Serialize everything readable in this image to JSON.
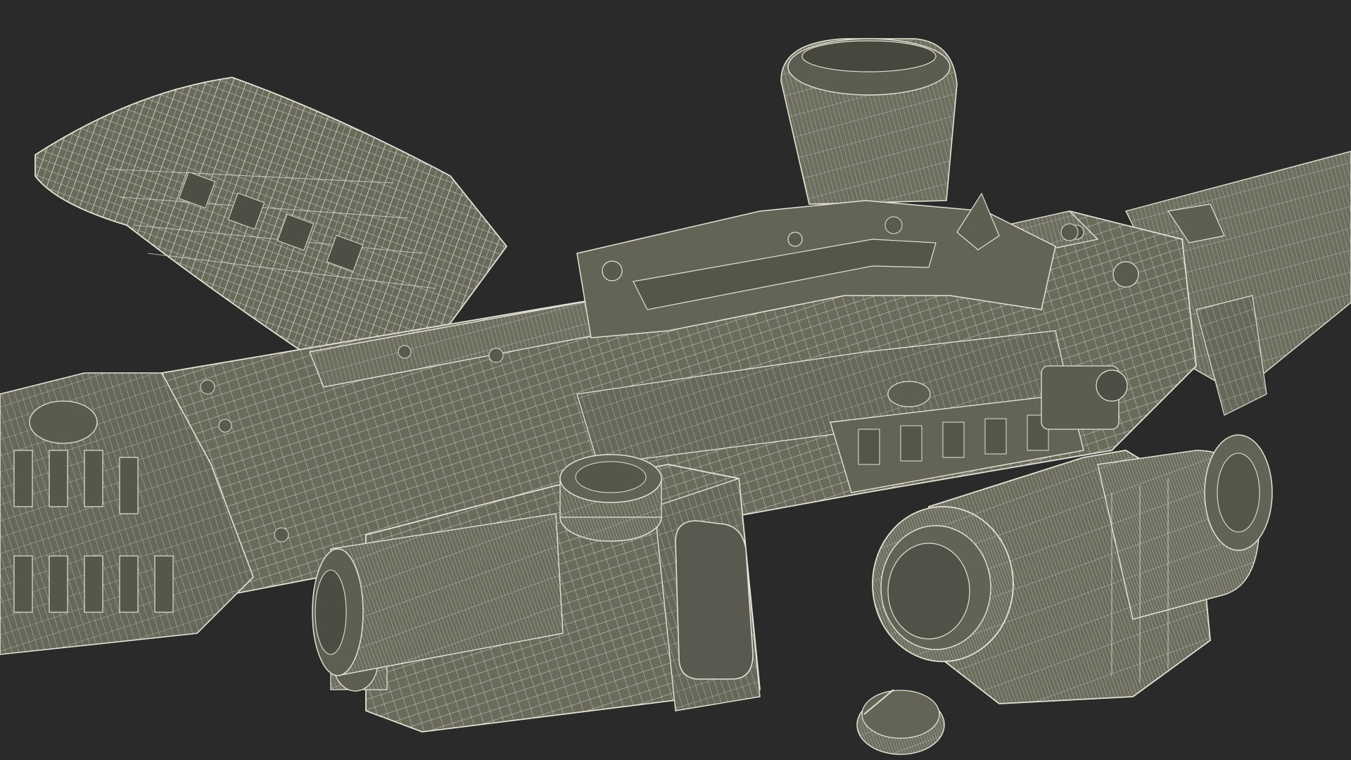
{
  "scene": {
    "subject": "wireframe-render",
    "background_color": "#2a2a2a",
    "surface_color": "#6b6b5c",
    "surface_shadow_color": "#55554a",
    "surface_highlight_color": "#7c7c6c",
    "wire_color": "#e4e2d6"
  }
}
